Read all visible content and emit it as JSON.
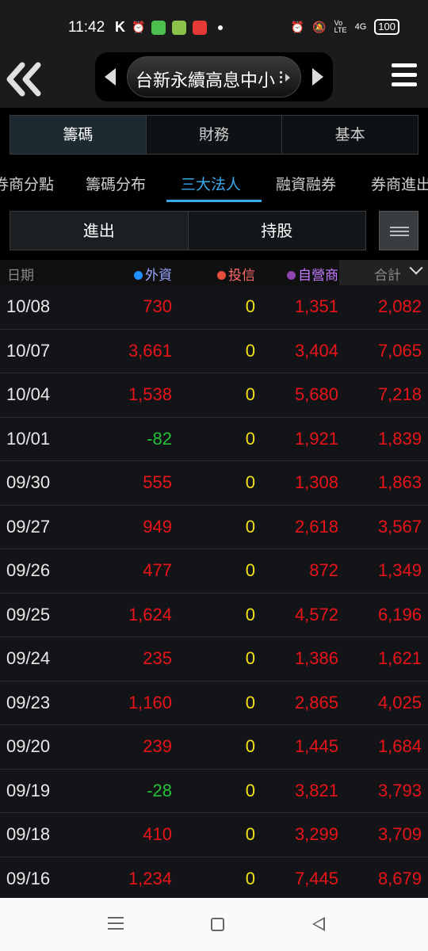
{
  "status_bar": {
    "time": "11:42",
    "k_icon": "K",
    "battery": "100",
    "network": "4G",
    "volte": "Vo LTE",
    "app_icon_colors": [
      "#4cc04c",
      "#8bc34a",
      "#e53935"
    ]
  },
  "header": {
    "stock_name": "台新永續高息中小",
    "back_icon": "double-chevron-left-icon",
    "menu_icon": "hamburger-icon"
  },
  "main_tabs": [
    {
      "label": "籌碼",
      "active": true
    },
    {
      "label": "財務",
      "active": false
    },
    {
      "label": "基本",
      "active": false
    }
  ],
  "sub_tabs": [
    {
      "label": "券商分點",
      "active": false
    },
    {
      "label": "籌碼分布",
      "active": false
    },
    {
      "label": "三大法人",
      "active": true
    },
    {
      "label": "融資融券",
      "active": false
    },
    {
      "label": "券商進出",
      "active": false
    }
  ],
  "segment": [
    {
      "label": "進出",
      "active": true
    },
    {
      "label": "持股",
      "active": false
    }
  ],
  "table": {
    "headers": {
      "date": "日期",
      "foreign": "外資",
      "trust": "投信",
      "dealer": "自營商",
      "total": "合計"
    },
    "header_dot_colors": {
      "foreign": "#1e90ff",
      "trust": "#e84c3d",
      "dealer": "#8e44ad"
    },
    "rows": [
      {
        "date": "10/08",
        "foreign": "730",
        "trust": "0",
        "dealer": "1,351",
        "total": "2,082"
      },
      {
        "date": "10/07",
        "foreign": "3,661",
        "trust": "0",
        "dealer": "3,404",
        "total": "7,065"
      },
      {
        "date": "10/04",
        "foreign": "1,538",
        "trust": "0",
        "dealer": "5,680",
        "total": "7,218"
      },
      {
        "date": "10/01",
        "foreign": "-82",
        "trust": "0",
        "dealer": "1,921",
        "total": "1,839"
      },
      {
        "date": "09/30",
        "foreign": "555",
        "trust": "0",
        "dealer": "1,308",
        "total": "1,863"
      },
      {
        "date": "09/27",
        "foreign": "949",
        "trust": "0",
        "dealer": "2,618",
        "total": "3,567"
      },
      {
        "date": "09/26",
        "foreign": "477",
        "trust": "0",
        "dealer": "872",
        "total": "1,349"
      },
      {
        "date": "09/25",
        "foreign": "1,624",
        "trust": "0",
        "dealer": "4,572",
        "total": "6,196"
      },
      {
        "date": "09/24",
        "foreign": "235",
        "trust": "0",
        "dealer": "1,386",
        "total": "1,621"
      },
      {
        "date": "09/23",
        "foreign": "1,160",
        "trust": "0",
        "dealer": "2,865",
        "total": "4,025"
      },
      {
        "date": "09/20",
        "foreign": "239",
        "trust": "0",
        "dealer": "1,445",
        "total": "1,684"
      },
      {
        "date": "09/19",
        "foreign": "-28",
        "trust": "0",
        "dealer": "3,821",
        "total": "3,793"
      },
      {
        "date": "09/18",
        "foreign": "410",
        "trust": "0",
        "dealer": "3,299",
        "total": "3,709"
      },
      {
        "date": "09/16",
        "foreign": "1,234",
        "trust": "0",
        "dealer": "7,445",
        "total": "8,679"
      }
    ]
  },
  "colors": {
    "positive": "#e8141a",
    "negative": "#23c23a",
    "zero": "#f2e11b",
    "accent": "#3aa8ea"
  }
}
